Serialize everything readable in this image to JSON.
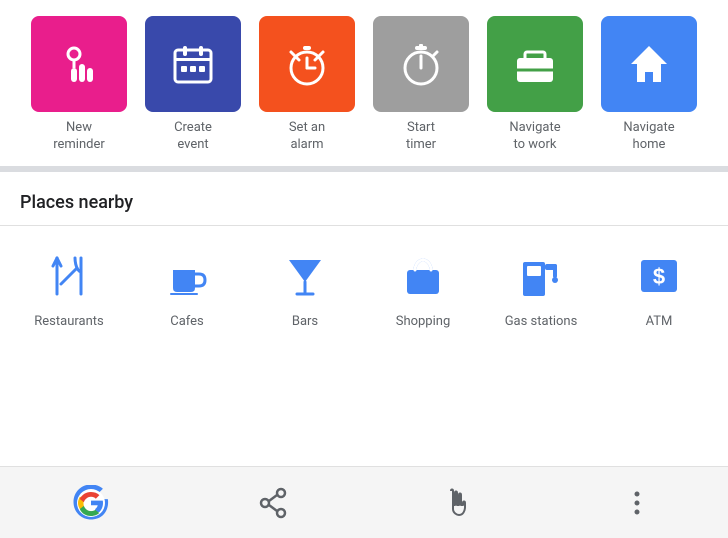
{
  "shortcuts": {
    "items": [
      {
        "id": "new-reminder",
        "label": "New\nreminder",
        "bg": "bg-pink",
        "icon": "reminder"
      },
      {
        "id": "create-event",
        "label": "Create\nevent",
        "bg": "bg-indigo",
        "icon": "event"
      },
      {
        "id": "set-alarm",
        "label": "Set an\nalarm",
        "bg": "bg-orange",
        "icon": "alarm"
      },
      {
        "id": "start-timer",
        "label": "Start\ntimer",
        "bg": "bg-gray",
        "icon": "timer"
      },
      {
        "id": "navigate-work",
        "label": "Navigate\nto work",
        "bg": "bg-green",
        "icon": "work"
      },
      {
        "id": "navigate-home",
        "label": "Navigate\nhome",
        "bg": "bg-blue",
        "icon": "home"
      }
    ]
  },
  "places": {
    "title": "Places nearby",
    "items": [
      {
        "id": "restaurants",
        "label": "Restaurants",
        "icon": "fork-knife"
      },
      {
        "id": "cafes",
        "label": "Cafes",
        "icon": "coffee"
      },
      {
        "id": "bars",
        "label": "Bars",
        "icon": "cocktail"
      },
      {
        "id": "shopping",
        "label": "Shopping",
        "icon": "shopping-bag"
      },
      {
        "id": "gas-stations",
        "label": "Gas stations",
        "icon": "gas-station"
      },
      {
        "id": "atm",
        "label": "ATM",
        "icon": "atm"
      }
    ]
  },
  "bottom_bar": {
    "items": [
      {
        "id": "google",
        "label": "Google"
      },
      {
        "id": "share",
        "label": "Share"
      },
      {
        "id": "touch",
        "label": "Touch"
      },
      {
        "id": "more",
        "label": "More"
      }
    ]
  }
}
